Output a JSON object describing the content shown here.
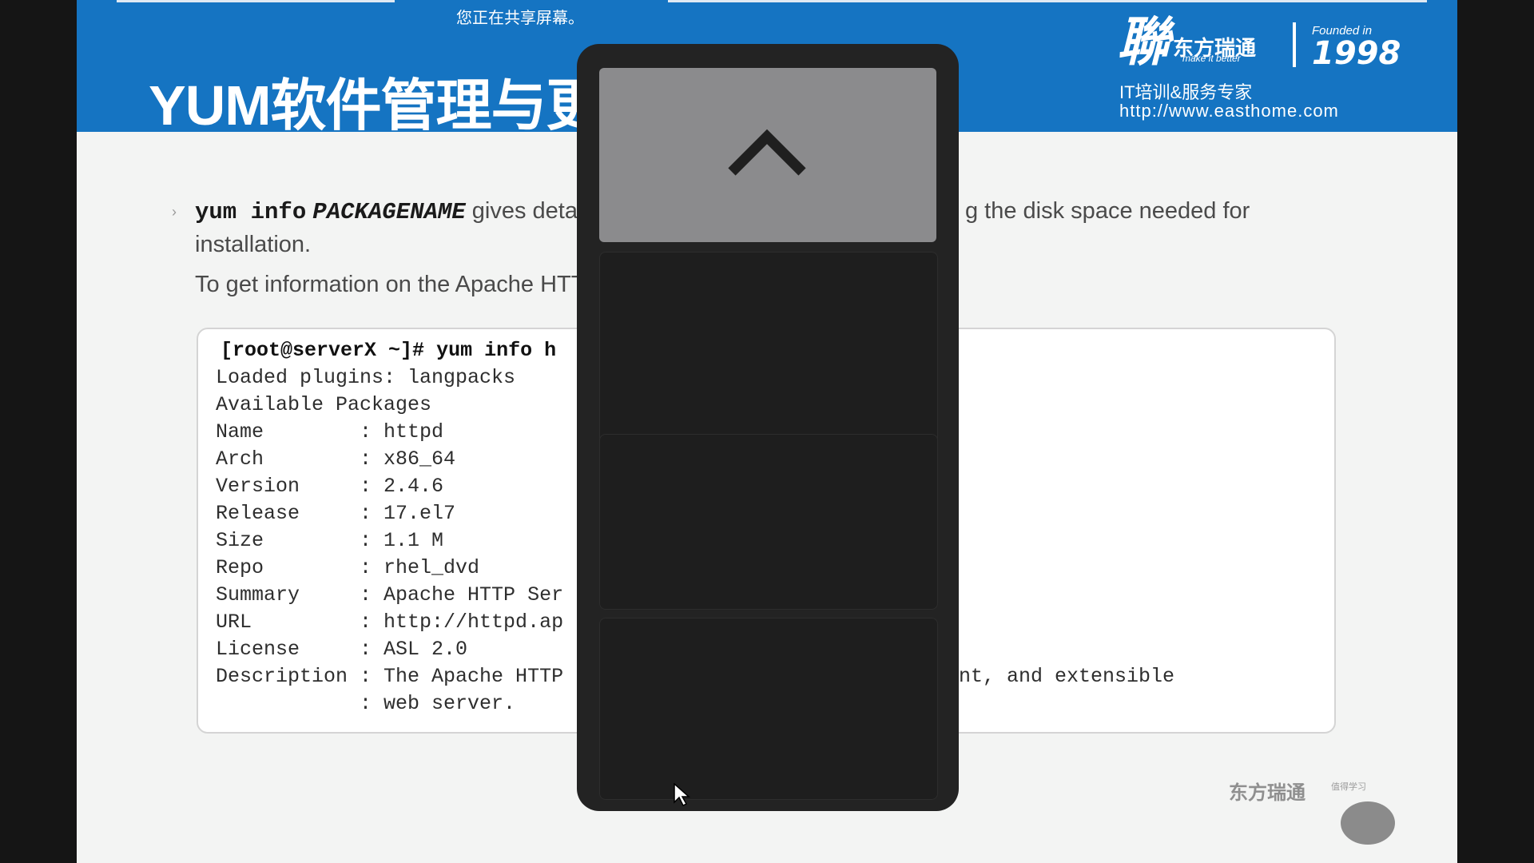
{
  "screen_share": {
    "notice": "您正在共享屏幕。"
  },
  "slide": {
    "title": "YUM软件管理与更",
    "logo": {
      "mark": "聯",
      "company_cn": "东方瑞通",
      "tagline_small": "make it better",
      "founded_label": "Founded in",
      "founded_year": "1998",
      "tagline": "IT培训&服务专家",
      "website": "http://www.easthome.com"
    },
    "bullet": {
      "command": "yum info",
      "argument": "PACKAGENAME",
      "text_left": "gives detaile",
      "text_right": "g the disk space needed for",
      "line2": "installation.",
      "line3": "To get information on the Apache HTTP"
    },
    "terminal": {
      "prompt": "[root@serverX ~]#",
      "command": "yum info h",
      "lines": [
        "Loaded plugins: langpacks",
        "Available Packages",
        "Name        : httpd",
        "Arch        : x86_64",
        "Version     : 2.4.6",
        "Release     : 17.el7",
        "Size        : 1.1 M",
        "Repo        : rhel_dvd",
        "Summary     : Apache HTTP Ser",
        "URL         : http://httpd.ap",
        "License     : ASL 2.0",
        "Description : The Apache HTTP",
        "            : web server."
      ],
      "description_tail": "nt, and extensible"
    },
    "footer": {
      "logo_cn": "东方瑞通",
      "logo_sub": "值得学习"
    }
  },
  "overlay_panel": {
    "up_icon": "chevron-up-icon",
    "slot_count": 4,
    "colors": {
      "panel": "#232323",
      "button": "#8b8b8d"
    }
  },
  "colors": {
    "banner": "#1574c2",
    "slide_bg": "#f3f4f3",
    "text": "#4a4a4a"
  }
}
